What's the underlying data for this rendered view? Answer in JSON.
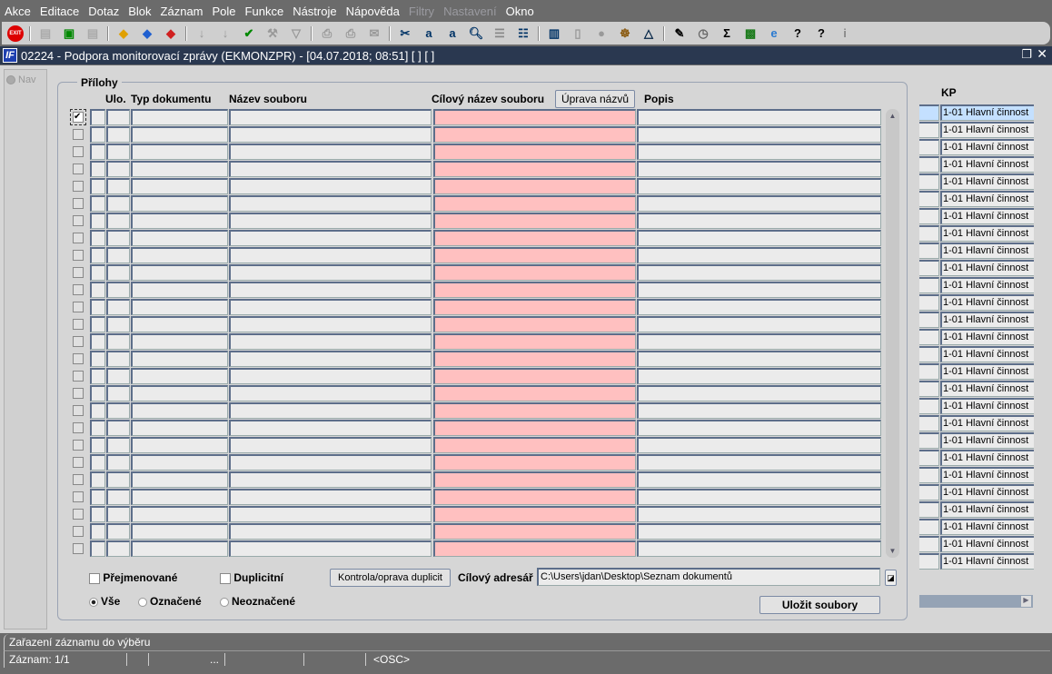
{
  "menu": [
    "Akce",
    "Editace",
    "Dotaz",
    "Blok",
    "Záznam",
    "Pole",
    "Funkce",
    "Nástroje",
    "Nápověda",
    "Filtry",
    "Nastavení",
    "Okno"
  ],
  "menu_disabled": [
    "Filtry",
    "Nastavení"
  ],
  "toolbar": {
    "exit": "EXIT"
  },
  "window": {
    "title": "02224 - Podpora monitorovací zprávy (EKMONZPR) - [04.07.2018; 08:51]  [ ]  [ ]",
    "logo": "IF"
  },
  "nav": {
    "label": "Nav"
  },
  "group": {
    "title": "Přílohy"
  },
  "table": {
    "headers": {
      "ulo": "Ulo.",
      "typ": "Typ dokumentu",
      "nazev": "Název souboru",
      "cilovy": "Cílový název souboru",
      "popis": "Popis"
    },
    "rename_button": "Úprava názvů",
    "row_count": 26,
    "checked_rows": [
      0
    ]
  },
  "kp": {
    "header": "KP",
    "rows": [
      "1-01 Hlavní činnost",
      "1-01 Hlavní činnost",
      "1-01 Hlavní činnost",
      "1-01 Hlavní činnost",
      "1-01 Hlavní činnost",
      "1-01 Hlavní činnost",
      "1-01 Hlavní činnost",
      "1-01 Hlavní činnost",
      "1-01 Hlavní činnost",
      "1-01 Hlavní činnost",
      "1-01 Hlavní činnost",
      "1-01 Hlavní činnost",
      "1-01 Hlavní činnost",
      "1-01 Hlavní činnost",
      "1-01 Hlavní činnost",
      "1-01 Hlavní činnost",
      "1-01 Hlavní činnost",
      "1-01 Hlavní činnost",
      "1-01 Hlavní činnost",
      "1-01 Hlavní činnost",
      "1-01 Hlavní činnost",
      "1-01 Hlavní činnost",
      "1-01 Hlavní činnost",
      "1-01 Hlavní činnost",
      "1-01 Hlavní činnost",
      "1-01 Hlavní činnost",
      "1-01 Hlavní činnost"
    ]
  },
  "bottom": {
    "prejmenovane": "Přejmenované",
    "duplicitni": "Duplicitní",
    "kontrola": "Kontrola/oprava duplicit",
    "cilovy_adresar_label": "Cílový adresář",
    "cilovy_adresar": "C:\\Users\\jdan\\Desktop\\Seznam dokumentů",
    "radio_vse": "Vše",
    "radio_oznacene": "Označené",
    "radio_neoznacene": "Neoznačené",
    "selected_radio": "Vše",
    "ulozit": "Uložit soubory"
  },
  "status": {
    "message": "Zařazení záznamu do výběru",
    "record": "Záznam: 1/1",
    "dots": "...",
    "mode": "<OSC>"
  },
  "colors": {
    "title_bar": "#2a3850",
    "target_name_field": "#ffc0c0",
    "selected_row": "#c4e0ff"
  }
}
